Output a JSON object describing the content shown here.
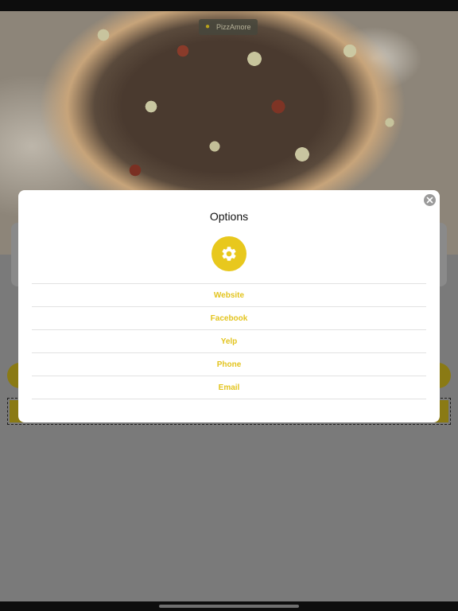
{
  "background": {
    "brand_chip": {
      "label": "PizzAmore",
      "icon": "location-pin-icon"
    }
  },
  "modal": {
    "title": "Options",
    "icon": "gear-icon",
    "close_icon": "close-icon",
    "options": [
      {
        "label": "Website"
      },
      {
        "label": "Facebook"
      },
      {
        "label": "Yelp"
      },
      {
        "label": "Phone"
      },
      {
        "label": "Email"
      }
    ]
  },
  "colors": {
    "accent": "#e8c81d",
    "option_text": "#e3c41e",
    "overlay_dim": "#7a7a7a"
  }
}
